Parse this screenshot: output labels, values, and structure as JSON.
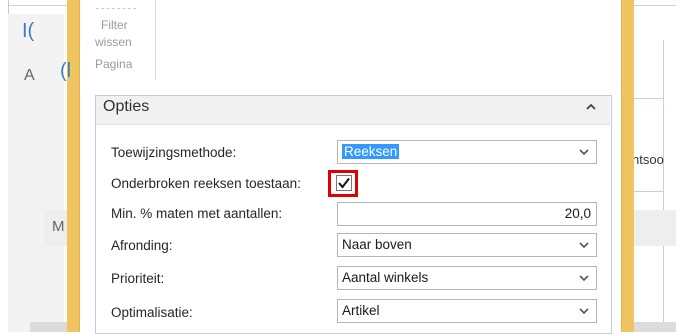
{
  "background": {
    "top_letter": "I(",
    "second_letter": "A",
    "paren_text": "(l",
    "m_letter": "M",
    "right_text": "ntsoo"
  },
  "ribbon": {
    "filter_line1": "Filter",
    "filter_line2": "wissen",
    "page_group": "Pagina"
  },
  "panel": {
    "title": "Opties",
    "collapse_icon": "chevron-up-icon"
  },
  "fields": {
    "toewijzing_label": "Toewijzingsmethode:",
    "toewijzing_value": "Reeksen",
    "onderbroken_label": "Onderbroken reeksen toestaan:",
    "onderbroken_checked": true,
    "min_label": "Min. % maten met aantallen:",
    "min_value": "20,0",
    "afronding_label": "Afronding:",
    "afronding_value": "Naar boven",
    "prioriteit_label": "Prioriteit:",
    "prioriteit_value": "Aantal winkels",
    "optimalisatie_label": "Optimalisatie:",
    "optimalisatie_value": "Artikel"
  },
  "colors": {
    "accent_yellow": "#f0c460",
    "highlight_red": "#e00000",
    "selection_blue": "#3399ff"
  }
}
